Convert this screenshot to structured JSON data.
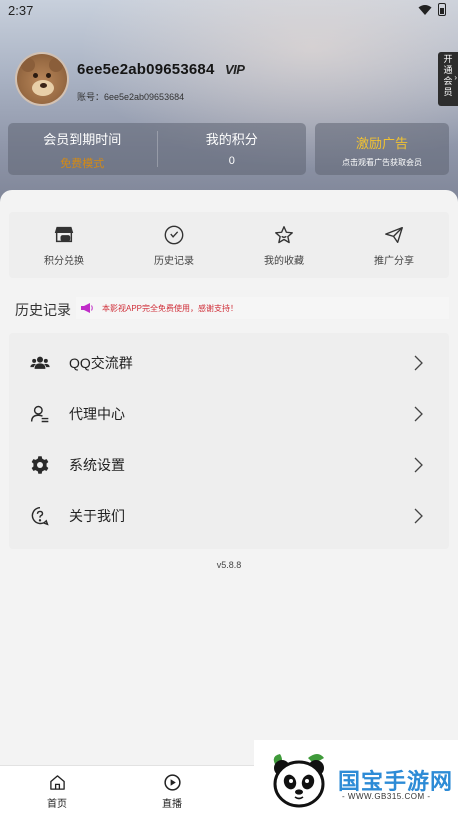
{
  "status_bar": {
    "time": "2:37"
  },
  "profile": {
    "username": "6ee5e2ab09653684",
    "vip_badge": "VIP",
    "account_label": "账号：6ee5e2ab09653684",
    "open_vip": "开通会员"
  },
  "stats": {
    "expiry_label": "会员到期时间",
    "expiry_value": "免费模式",
    "points_label": "我的积分",
    "points_value": "0",
    "ad_title": "激励广告",
    "ad_subtitle": "点击观看广告获取会员"
  },
  "quick_actions": [
    {
      "label": "积分兑换",
      "icon": "store-icon"
    },
    {
      "label": "历史记录",
      "icon": "clock-icon"
    },
    {
      "label": "我的收藏",
      "icon": "star-icon"
    },
    {
      "label": "推广分享",
      "icon": "send-icon"
    }
  ],
  "history": {
    "title": "历史记录",
    "notice": "本影视APP完全免费使用，感谢支持！"
  },
  "menu": [
    {
      "label": "QQ交流群",
      "icon": "group-icon"
    },
    {
      "label": "代理中心",
      "icon": "agent-icon"
    },
    {
      "label": "系统设置",
      "icon": "settings-icon"
    },
    {
      "label": "关于我们",
      "icon": "help-icon"
    }
  ],
  "version": "v5.8.8",
  "bottom_nav": [
    {
      "label": "首页",
      "icon": "home-icon"
    },
    {
      "label": "直播",
      "icon": "play-icon"
    }
  ],
  "watermark": {
    "title": "国宝手游网",
    "url": "- WWW.GB315.COM -"
  },
  "colors": {
    "accent_orange": "#d48a14",
    "ad_gold": "#f1c232",
    "notice_red": "#d0303a",
    "watermark_blue": "#2d8bd6"
  }
}
